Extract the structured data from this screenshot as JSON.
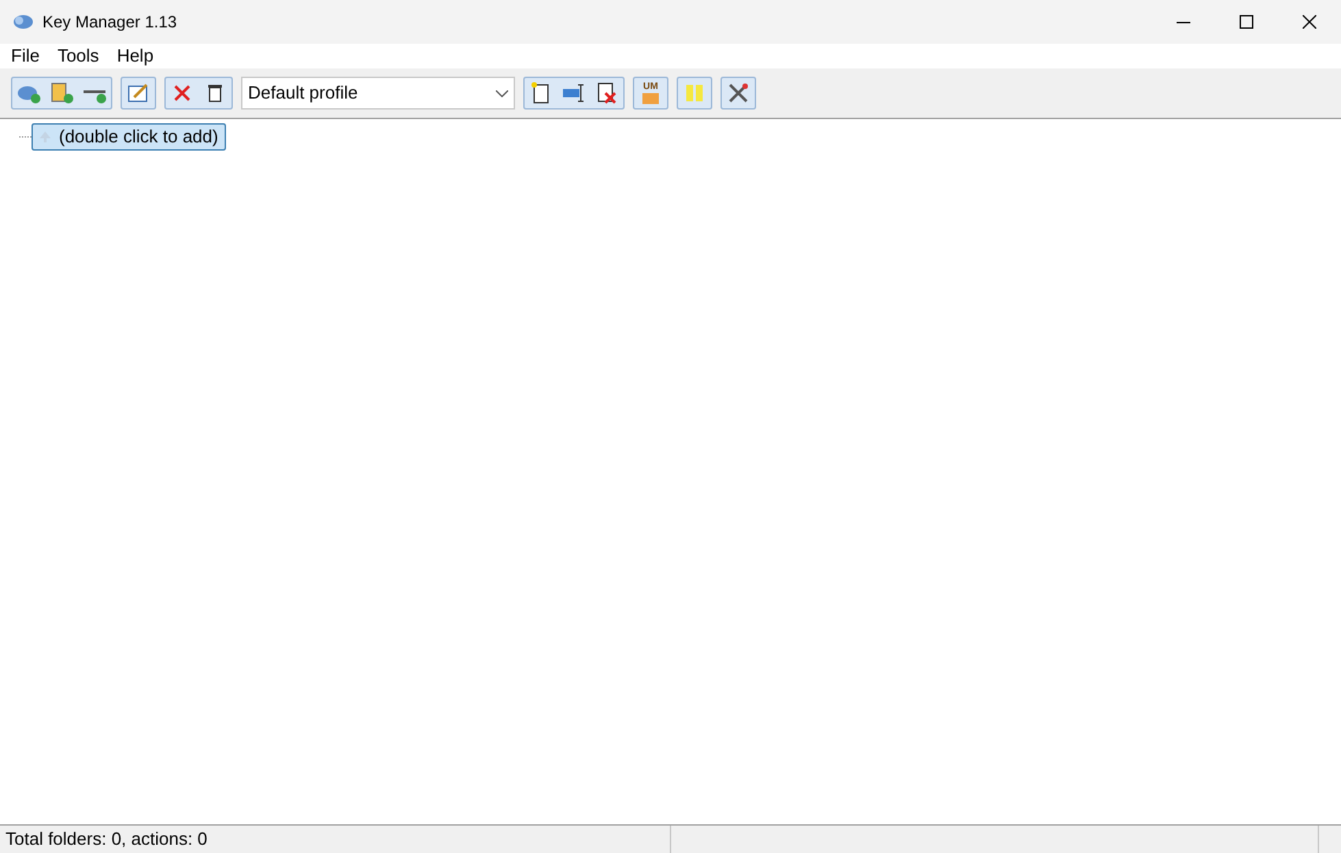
{
  "window": {
    "title": "Key Manager 1.13"
  },
  "menu": [
    "File",
    "Tools",
    "Help"
  ],
  "toolbar": {
    "profile": "Default profile",
    "badge_text": "UM"
  },
  "tree": {
    "items": [
      {
        "label": "(double click to add)",
        "selected": true
      }
    ]
  },
  "status_bar": {
    "text": "Total folders: 0, actions: 0"
  }
}
